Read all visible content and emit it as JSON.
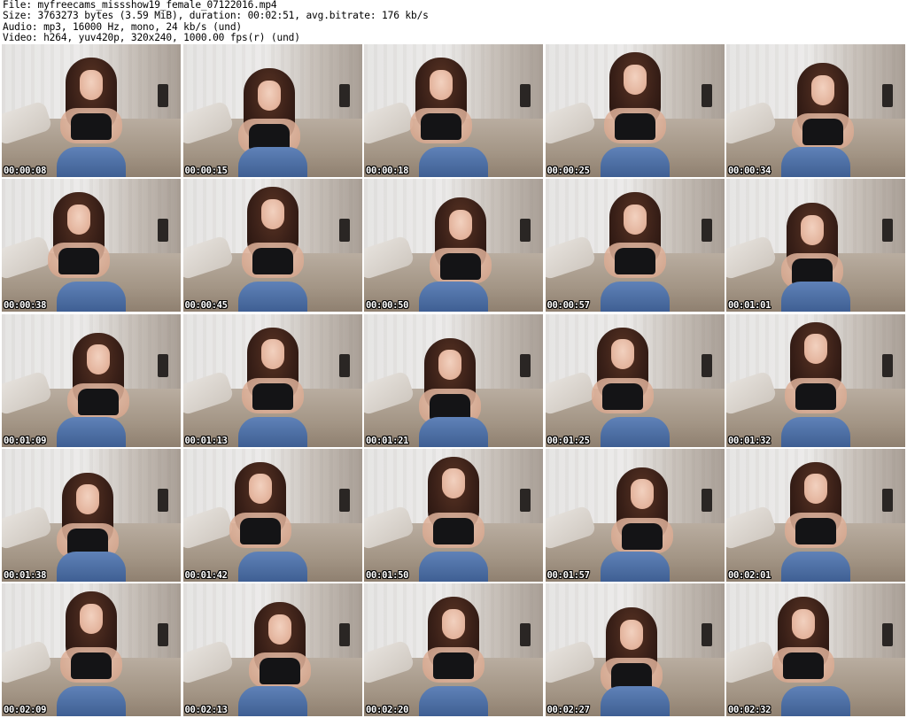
{
  "header": {
    "file_line": "File: myfreecams_missshow19_female_07122016.mp4",
    "size_line": "Size: 3763273 bytes (3.59 MiB), duration: 00:02:51, avg.bitrate: 176 kb/s",
    "audio_line": "Audio: mp3, 16000 Hz, mono, 24 kb/s (und)",
    "video_line": "Video: h264, yuv420p, 320x240, 1000.00 fps(r) (und)"
  },
  "thumbnails": [
    {
      "timestamp": "00:00:08"
    },
    {
      "timestamp": "00:00:15"
    },
    {
      "timestamp": "00:00:18"
    },
    {
      "timestamp": "00:00:25"
    },
    {
      "timestamp": "00:00:34"
    },
    {
      "timestamp": "00:00:38"
    },
    {
      "timestamp": "00:00:45"
    },
    {
      "timestamp": "00:00:50"
    },
    {
      "timestamp": "00:00:57"
    },
    {
      "timestamp": "00:01:01"
    },
    {
      "timestamp": "00:01:09"
    },
    {
      "timestamp": "00:01:13"
    },
    {
      "timestamp": "00:01:21"
    },
    {
      "timestamp": "00:01:25"
    },
    {
      "timestamp": "00:01:32"
    },
    {
      "timestamp": "00:01:38"
    },
    {
      "timestamp": "00:01:42"
    },
    {
      "timestamp": "00:01:50"
    },
    {
      "timestamp": "00:01:57"
    },
    {
      "timestamp": "00:02:01"
    },
    {
      "timestamp": "00:02:09"
    },
    {
      "timestamp": "00:02:13"
    },
    {
      "timestamp": "00:02:20"
    },
    {
      "timestamp": "00:02:27"
    },
    {
      "timestamp": "00:02:32"
    }
  ]
}
